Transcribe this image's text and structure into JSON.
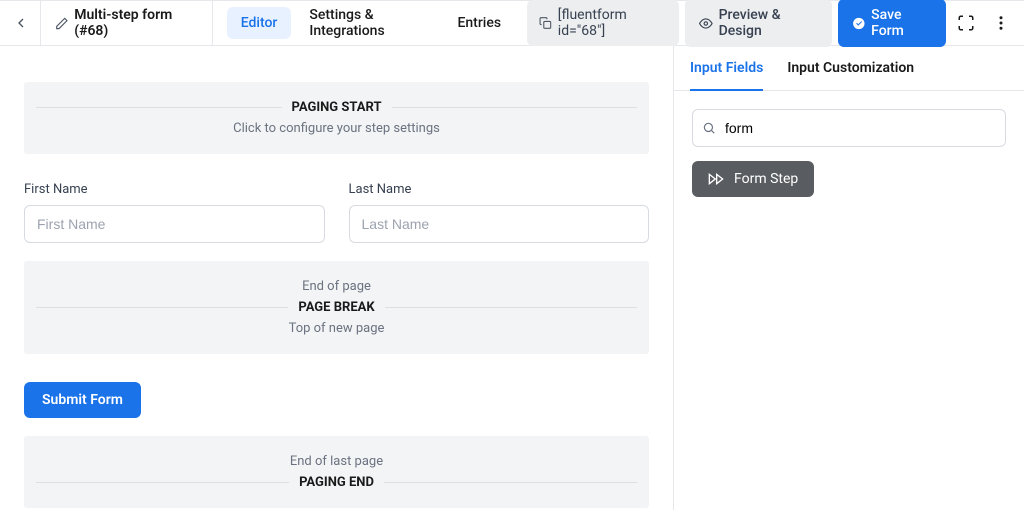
{
  "header": {
    "title": "Multi-step form (#68)",
    "tabs": {
      "editor": "Editor",
      "settings": "Settings & Integrations",
      "entries": "Entries"
    },
    "shortcode": "[fluentform id=\"68\"]",
    "preview_btn": "Preview & Design",
    "save_btn": "Save Form"
  },
  "canvas": {
    "paging_start": {
      "title": "PAGING START",
      "sub": "Click to configure your step settings"
    },
    "first_name": {
      "label": "First Name",
      "placeholder": "First Name"
    },
    "last_name": {
      "label": "Last Name",
      "placeholder": "Last Name"
    },
    "page_break": {
      "supra": "End of page",
      "title": "PAGE BREAK",
      "sub": "Top of new page"
    },
    "submit_label": "Submit Form",
    "paging_end": {
      "supra": "End of last page",
      "title": "PAGING END"
    }
  },
  "sidebar": {
    "tabs": {
      "input_fields": "Input Fields",
      "input_customization": "Input Customization"
    },
    "search_value": "form",
    "form_step_label": "Form Step"
  }
}
